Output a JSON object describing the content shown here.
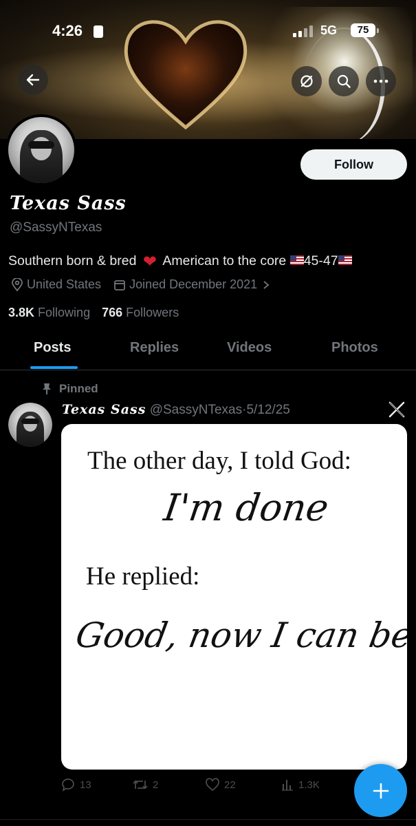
{
  "status_bar": {
    "time": "4:26",
    "network": "5G",
    "battery": "75"
  },
  "profile": {
    "display_name": "Texas Sass",
    "handle": "@SassyNTexas",
    "follow_label": "Follow",
    "bio_part1": "Southern born & bred",
    "bio_part2": "American to the core",
    "bio_part3": "45-47",
    "location": "United States",
    "joined": "Joined December 2021",
    "following_count": "3.8K",
    "following_label": "Following",
    "followers_count": "766",
    "followers_label": "Followers"
  },
  "tabs": [
    {
      "label": "Posts",
      "active": true
    },
    {
      "label": "Replies",
      "active": false
    },
    {
      "label": "Videos",
      "active": false
    },
    {
      "label": "Photos",
      "active": false
    }
  ],
  "tweet": {
    "pinned_label": "Pinned",
    "author_name": "Texas Sass",
    "author_handle": "@SassyNTexas",
    "separator": "·",
    "date": "5/12/25",
    "image_text": {
      "line1": "The other day, I told God:",
      "line2": "I'm done",
      "line3": "He replied:",
      "line4": "Good, now I can begin."
    },
    "replies": "13",
    "reposts": "2",
    "likes": "22",
    "views": "1.3K"
  },
  "colors": {
    "accent": "#1d9bf0",
    "muted": "#71767b",
    "heart": "#d2202d"
  },
  "icons": [
    "back-arrow-icon",
    "grok-icon",
    "search-icon",
    "more-icon",
    "location-icon",
    "calendar-icon",
    "chevron-right-icon",
    "pin-icon",
    "x-logo-icon",
    "reply-icon",
    "repost-icon",
    "like-icon",
    "views-icon",
    "plus-icon"
  ]
}
